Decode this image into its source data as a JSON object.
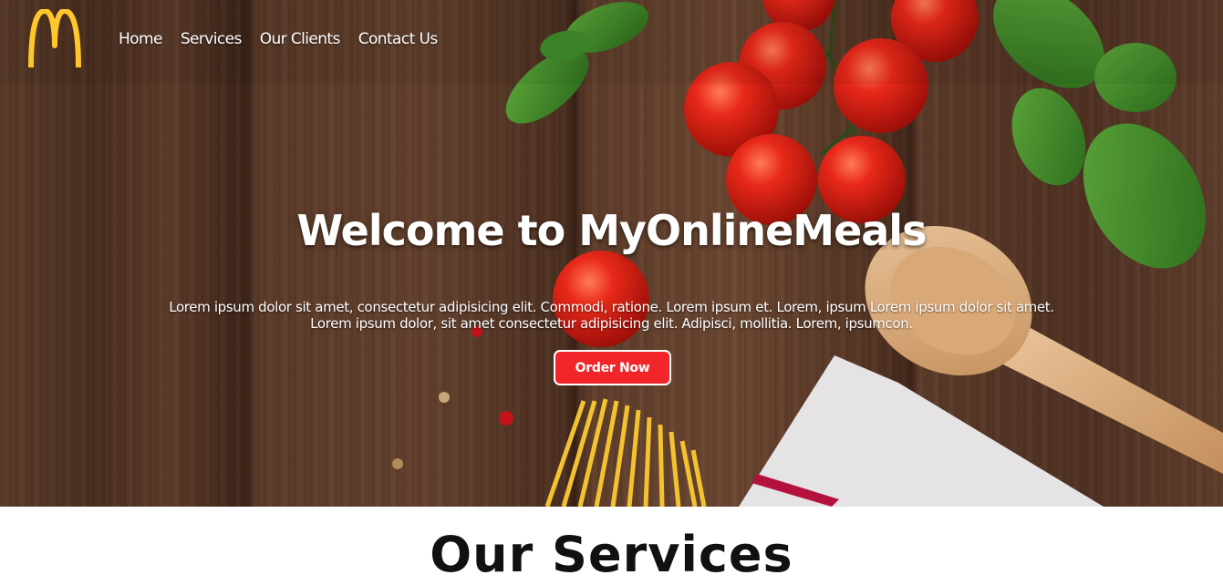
{
  "brand": {
    "logo_icon": "golden-arches-icon",
    "logo_color": "#ffc72c"
  },
  "nav": {
    "items": [
      {
        "label": "Home"
      },
      {
        "label": "Services"
      },
      {
        "label": "Our Clients"
      },
      {
        "label": "Contact Us"
      }
    ]
  },
  "hero": {
    "title": "Welcome to MyOnlineMeals",
    "text_line1": "Lorem ipsum dolor sit amet, consectetur adipisicing elit. Commodi, ratione. Lorem ipsum et. Lorem, ipsum Lorem ipsum dolor sit amet.",
    "text_line2": "Lorem ipsum dolor, sit amet consectetur adipisicing elit. Adipisci, mollitia. Lorem, ipsumcon.",
    "button_label": "Order Now",
    "button_color": "#f0262b"
  },
  "services": {
    "title": "Our Services"
  }
}
